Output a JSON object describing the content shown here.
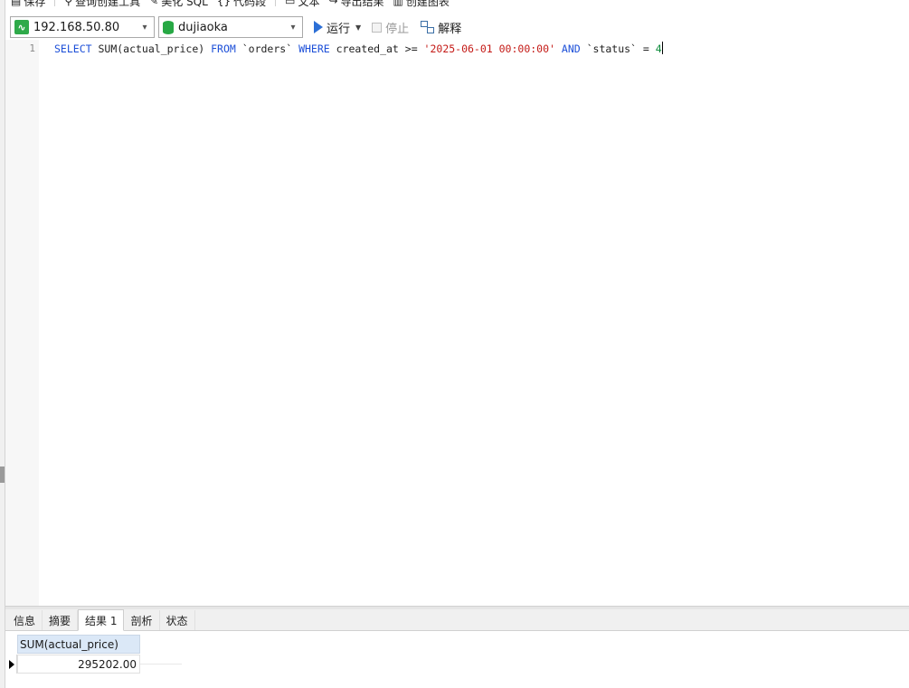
{
  "toolbar_top": {
    "items": [
      "保存",
      "查询创建工具",
      "美化 SQL",
      "代码段",
      "文本",
      "导出结果",
      "创建图表"
    ]
  },
  "toolbar": {
    "connection": "192.168.50.80",
    "database": "dujiaoka",
    "run_label": "运行",
    "stop_label": "停止",
    "explain_label": "解释"
  },
  "editor": {
    "line_number": "1",
    "code": {
      "t1": "SELECT",
      "t2": " SUM(actual_price) ",
      "t3": "FROM",
      "t4": " `orders` ",
      "t5": "WHERE",
      "t6": " created_at >= ",
      "t7": "'2025-06-01 00:00:00'",
      "t8": " ",
      "t9": "AND",
      "t10": " `status` = ",
      "t11": "4"
    }
  },
  "bottom_tabs": [
    "信息",
    "摘要",
    "结果 1",
    "剖析",
    "状态"
  ],
  "result": {
    "column": "SUM(actual_price)",
    "value": "295202.00"
  },
  "colors": {
    "keyword": "#1c4fd8",
    "string": "#c41a16",
    "number": "#0b8a3a",
    "header_bg": "#dbe8f7",
    "accent_green": "#27a844"
  }
}
